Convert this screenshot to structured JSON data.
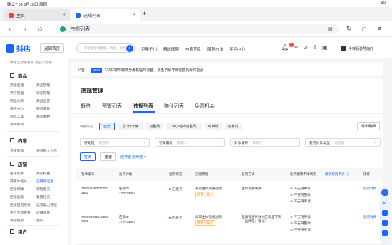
{
  "status_bar": {
    "time": "晚上7:59 5月15日 周四",
    "right": "⋯",
    "battery": "4% "
  },
  "browser": {
    "tabs": [
      {
        "label": "主页",
        "active": false
      },
      {
        "label": "违规列表",
        "active": true
      }
    ],
    "new_tab": "+",
    "address": "违规列表"
  },
  "app_header": {
    "logo": "抖店",
    "back_home": "返回首页",
    "search_placeholder": "可搜索全局数据、功能、文档",
    "nav": [
      "巨量千川",
      "精选联盟",
      "电商罗盘",
      "服务市场",
      "学习中心"
    ],
    "notification_count": "1",
    "user": "半琳服装号临时"
  },
  "sidebar": {
    "top_cut": "供给区数据看板  商品口吐稿",
    "sections": [
      {
        "title": "商品",
        "items": [
          [
            "商品创建",
            "商品管理"
          ],
          [
            "评价管理",
            "库存管理"
          ],
          [
            "商品诊断",
            "商品运营"
          ],
          [
            "商机中心",
            "商品成长"
          ],
          [
            "商品工具",
            "商品素材"
          ],
          [
            "源头好货"
          ]
        ]
      },
      {
        "title": "内容",
        "items": [
          [
            "直播管理",
            "视频图文创作"
          ]
        ]
      },
      {
        "title": "店铺",
        "items": [
          [
            "店铺装修",
            "商家权益"
          ],
          [
            "商家体验分",
            "店铺保证金"
          ],
          [
            "店铺保障",
            "保险服务"
          ],
          [
            "店铺层级",
            "客服任务"
          ],
          [
            "店铺回流成长",
            "运营能力管理"
          ],
          [
            "平价专项提升",
            "店铺资质"
          ],
          [
            "商铺经营",
            "更多"
          ]
        ]
      },
      {
        "title": "用户",
        "items": []
      }
    ]
  },
  "notice": {
    "label": "公告",
    "tag": "NEW",
    "text": "618好物节物流分考核临时调整，点击了解详细信息及操作指引"
  },
  "page": {
    "title": "违规管理",
    "tabs": [
      "概览",
      "预警列表",
      "违规列表",
      "赔付列表",
      "免罚机会"
    ],
    "active_tab": "违规列表",
    "export_label": "导出明细",
    "quick_filter_label": "快捷筛选",
    "quick_filters": [
      "全部",
      "近7日未读",
      "可整改",
      "24小时内可整改",
      "可申诉",
      "可考试"
    ],
    "fields": [
      {
        "label": "待处理",
        "placeholder": "请选择",
        "dropdown": true
      },
      {
        "label": "罚单编号",
        "placeholder": "请输入",
        "dropdown": false
      },
      {
        "label": "对象编号",
        "placeholder": "请输入",
        "dropdown": false
      },
      {
        "label": "处罚对象类型",
        "placeholder": "请选择",
        "dropdown": true
      }
    ],
    "query_label": "查询",
    "reset_label": "重置",
    "expand_label": "展开更多筛选 ∨"
  },
  "table": {
    "columns": [
      "罚单编号",
      "处罚对象",
      "处罚状态",
      "违规原因",
      "处罚方式",
      "处罚撤销申请状态",
      "操作"
    ],
    "header_extra": "撤销规则申诉 ⓘ",
    "rows": [
      {
        "ticket": "7501054937300071882",
        "object_label": "店铺ID",
        "object_id": "179733967",
        "status": "已处罚",
        "reason": "商家主体资质过期",
        "level": "限罚一级 ⓘ",
        "method": "主体资质失效",
        "appeals": [
          "不支持申诉",
          "不支持整改",
          "不支持考试"
        ],
        "action": "处罚详情"
      },
      {
        "ticket": "7490639015190567839",
        "object_label": "店铺ID",
        "object_id": "179733967",
        "status": "已处罚",
        "reason": "商家主体资质过期",
        "level": "限罚一级 ⓘ",
        "method": "品牌资质失效对应商品下架（品牌是：每好）",
        "appeals": [
          "不支持申诉",
          "不支持整改",
          "不支持考试"
        ],
        "action": "处罚详情"
      }
    ]
  },
  "floating": {
    "ai_label": "AI"
  }
}
